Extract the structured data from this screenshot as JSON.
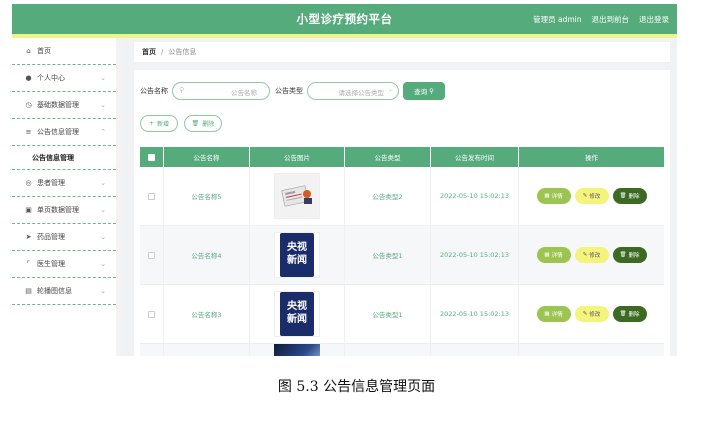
{
  "header": {
    "title": "小型诊疗预约平台",
    "user": "管理员 admin",
    "to_front": "退出到前台",
    "logout": "退出登录",
    "accent": "#56ab7c"
  },
  "sidebar": {
    "items": [
      {
        "label": "首页",
        "icon": "home-icon"
      },
      {
        "label": "个人中心",
        "icon": "user-icon"
      },
      {
        "label": "基础数据管理",
        "icon": "clock-icon"
      },
      {
        "label": "公告信息管理",
        "icon": "list-icon"
      },
      {
        "label": "患者管理",
        "icon": "globe-icon"
      },
      {
        "label": "单页数据管理",
        "icon": "printer-icon"
      },
      {
        "label": "药品管理",
        "icon": "send-icon"
      },
      {
        "label": "医生管理",
        "icon": "crop-icon"
      },
      {
        "label": "轮播图信息",
        "icon": "clipboard-icon"
      }
    ],
    "sub_active": "公告信息管理"
  },
  "breadcrumb": {
    "home": "首页",
    "sep": "/",
    "current": "公告信息"
  },
  "search": {
    "name_label": "公告名称",
    "name_placeholder": "公告名称",
    "type_label": "公告类型",
    "type_placeholder": "请选择公告类型",
    "query_button": "查询"
  },
  "actions": {
    "add": "新增",
    "delete": "删除"
  },
  "table": {
    "headers": [
      "公告名称",
      "公告图片",
      "公告类型",
      "公告发布时间",
      "操作"
    ],
    "rows": [
      {
        "name": "公告名称5",
        "type": "公告类型2",
        "time": "2022-05-10 15:02:13",
        "image": "newspaper"
      },
      {
        "name": "公告名称4",
        "type": "公告类型1",
        "time": "2022-05-10 15:02:13",
        "image": "cctv-news"
      },
      {
        "name": "公告名称3",
        "type": "公告类型1",
        "time": "2022-05-10 15:02:13",
        "image": "cctv-news"
      }
    ],
    "row_buttons": {
      "detail": "详情",
      "edit": "修改",
      "delete": "删除"
    },
    "cctv_top": "央视",
    "cctv_bottom": "新闻"
  },
  "caption": "图 5.3  公告信息管理页面"
}
